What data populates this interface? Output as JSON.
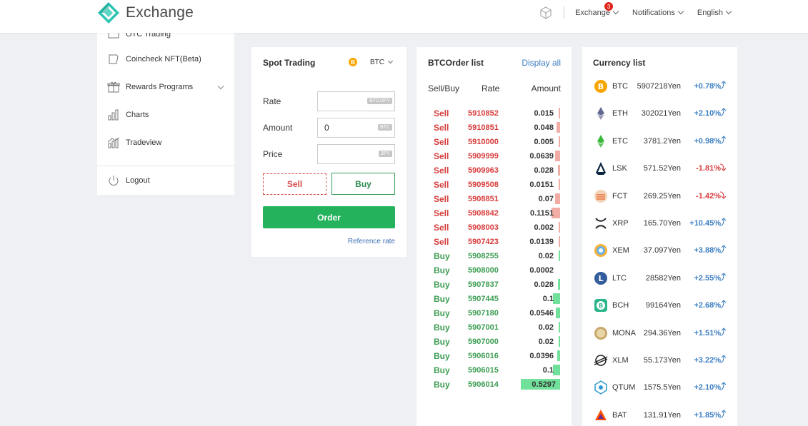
{
  "header": {
    "brand": "Exchange",
    "menu": [
      {
        "label": "Exchange",
        "badge": "3"
      },
      {
        "label": "Notifications"
      },
      {
        "label": "English"
      }
    ]
  },
  "sidebar": {
    "items": [
      {
        "label": "OTC Trading",
        "icon": "otc-icon"
      },
      {
        "label": "Coincheck NFT(Beta)",
        "icon": "nft-icon"
      },
      {
        "label": "Rewards Programs",
        "icon": "gift-icon",
        "expandable": true
      },
      {
        "label": "Charts",
        "icon": "bar-chart-icon"
      },
      {
        "label": "Tradeview",
        "icon": "tradeview-icon"
      }
    ],
    "logout": "Logout"
  },
  "spot": {
    "title": "Spot Trading",
    "coin_symbol": "B",
    "coin": "BTC",
    "rate_label": "Rate",
    "rate_value": "",
    "rate_unit": "BTC/JPY",
    "amount_label": "Amount",
    "amount_value": "0",
    "amount_unit": "BTC",
    "price_label": "Price",
    "price_value": "",
    "price_unit": "JPY",
    "sell": "Sell",
    "buy": "Buy",
    "order": "Order",
    "reference": "Reference rate"
  },
  "orders": {
    "title": "BTCOrder list",
    "display_all": "Display all",
    "col_side": "Sell/Buy",
    "col_rate": "Rate",
    "col_amount": "Amount",
    "rows": [
      {
        "side": "Sell",
        "rate": "5910852",
        "amount": "0.015",
        "fill": 0.03
      },
      {
        "side": "Sell",
        "rate": "5910851",
        "amount": "0.048",
        "fill": 0.09
      },
      {
        "side": "Sell",
        "rate": "5910000",
        "amount": "0.005",
        "fill": 0.02
      },
      {
        "side": "Sell",
        "rate": "5909999",
        "amount": "0.0639",
        "fill": 0.12
      },
      {
        "side": "Sell",
        "rate": "5909963",
        "amount": "0.028",
        "fill": 0.05
      },
      {
        "side": "Sell",
        "rate": "5909508",
        "amount": "0.0151",
        "fill": 0.03
      },
      {
        "side": "Sell",
        "rate": "5908851",
        "amount": "0.07",
        "fill": 0.13
      },
      {
        "side": "Sell",
        "rate": "5908842",
        "amount": "0.1151",
        "fill": 0.22
      },
      {
        "side": "Sell",
        "rate": "5908003",
        "amount": "0.002",
        "fill": 0.02
      },
      {
        "side": "Sell",
        "rate": "5907423",
        "amount": "0.0139",
        "fill": 0.03
      },
      {
        "side": "Buy",
        "rate": "5908255",
        "amount": "0.02",
        "fill": 0.04
      },
      {
        "side": "Buy",
        "rate": "5908000",
        "amount": "0.0002",
        "fill": 0.0
      },
      {
        "side": "Buy",
        "rate": "5907837",
        "amount": "0.028",
        "fill": 0.05
      },
      {
        "side": "Buy",
        "rate": "5907445",
        "amount": "0.1",
        "fill": 0.19
      },
      {
        "side": "Buy",
        "rate": "5907180",
        "amount": "0.0546",
        "fill": 0.1
      },
      {
        "side": "Buy",
        "rate": "5907001",
        "amount": "0.02",
        "fill": 0.04
      },
      {
        "side": "Buy",
        "rate": "5907000",
        "amount": "0.02",
        "fill": 0.04
      },
      {
        "side": "Buy",
        "rate": "5906016",
        "amount": "0.0396",
        "fill": 0.07
      },
      {
        "side": "Buy",
        "rate": "5906015",
        "amount": "0.1",
        "fill": 0.19
      },
      {
        "side": "Buy",
        "rate": "5906014",
        "amount": "0.5297",
        "fill": 1.0
      }
    ]
  },
  "currency": {
    "title": "Currency list",
    "rows": [
      {
        "sym": "BTC",
        "price": "5907218Yen",
        "change": "+0.78%",
        "dir": "up",
        "icon": "bitcoin-icon",
        "color": "#f7a600"
      },
      {
        "sym": "ETH",
        "price": "302021Yen",
        "change": "+2.10%",
        "dir": "up",
        "icon": "ethereum-icon",
        "color": "#62688f"
      },
      {
        "sym": "ETC",
        "price": "3781.2Yen",
        "change": "+0.98%",
        "dir": "up",
        "icon": "ethereum-classic-icon",
        "color": "#3ab83a"
      },
      {
        "sym": "LSK",
        "price": "571.52Yen",
        "change": "-1.81%",
        "dir": "down",
        "icon": "lisk-icon",
        "color": "#0a2540"
      },
      {
        "sym": "FCT",
        "price": "269.25Yen",
        "change": "-1.42%",
        "dir": "down",
        "icon": "factom-icon",
        "color": "#e9743d"
      },
      {
        "sym": "XRP",
        "price": "165.70Yen",
        "change": "+10.45%",
        "dir": "up",
        "icon": "xrp-icon",
        "color": "#23292f"
      },
      {
        "sym": "XEM",
        "price": "37.097Yen",
        "change": "+3.88%",
        "dir": "up",
        "icon": "nem-icon",
        "color": "#67b2e8"
      },
      {
        "sym": "LTC",
        "price": "28582Yen",
        "change": "+2.55%",
        "dir": "up",
        "icon": "litecoin-icon",
        "color": "#345d9d"
      },
      {
        "sym": "BCH",
        "price": "99164Yen",
        "change": "+2.68%",
        "dir": "up",
        "icon": "bitcoin-cash-icon",
        "color": "#2bb58a"
      },
      {
        "sym": "MONA",
        "price": "294.36Yen",
        "change": "+1.51%",
        "dir": "up",
        "icon": "monacoin-icon",
        "color": "#c9a86b"
      },
      {
        "sym": "XLM",
        "price": "55.173Yen",
        "change": "+3.22%",
        "dir": "up",
        "icon": "stellar-icon",
        "color": "#1d1d1d"
      },
      {
        "sym": "QTUM",
        "price": "1575.5Yen",
        "change": "+2.10%",
        "dir": "up",
        "icon": "qtum-icon",
        "color": "#2e9ad0"
      },
      {
        "sym": "BAT",
        "price": "131.91Yen",
        "change": "+1.85%",
        "dir": "up",
        "icon": "bat-icon",
        "color": "#ff5000"
      }
    ]
  }
}
